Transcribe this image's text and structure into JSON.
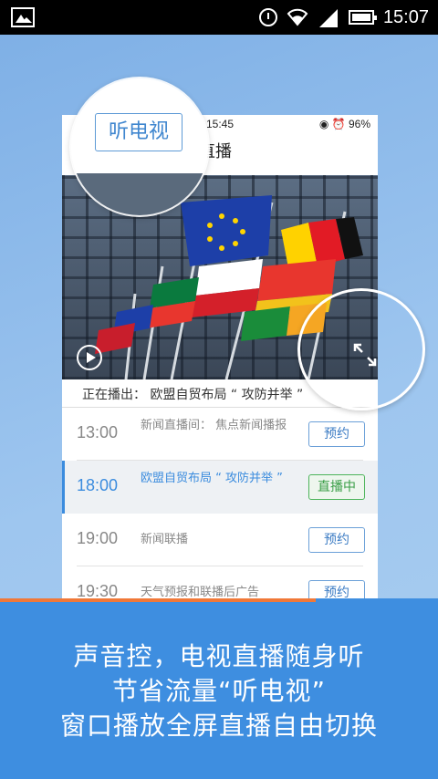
{
  "status_bar": {
    "time": "15:07"
  },
  "phone": {
    "status_time": "15:45",
    "battery": "96%",
    "title": "直播",
    "now_playing": "正在播出：  欧盟自贸布局 “ 攻防并举 ”"
  },
  "zoom_tag": "听电视",
  "schedule": [
    {
      "time": "13:00",
      "program": "新闻直播间：  焦点新闻播报",
      "action": "预约",
      "live": false
    },
    {
      "time": "18:00",
      "program": "欧盟自贸布局 “ 攻防并举 ”",
      "action": "直播中",
      "live": true
    },
    {
      "time": "19:00",
      "program": "新闻联播",
      "action": "预约",
      "live": false
    },
    {
      "time": "19:30",
      "program": "天气预报和联播后广告",
      "action": "预约",
      "live": false
    }
  ],
  "progress": 0.72,
  "captions": [
    "声音控，电视直播随身听",
    "节省流量“听电视”",
    "窗口播放全屏直播自由切换"
  ],
  "colors": {
    "accent": "#3e8ee0",
    "progress": "#f07838",
    "live": "#4cb45a"
  }
}
